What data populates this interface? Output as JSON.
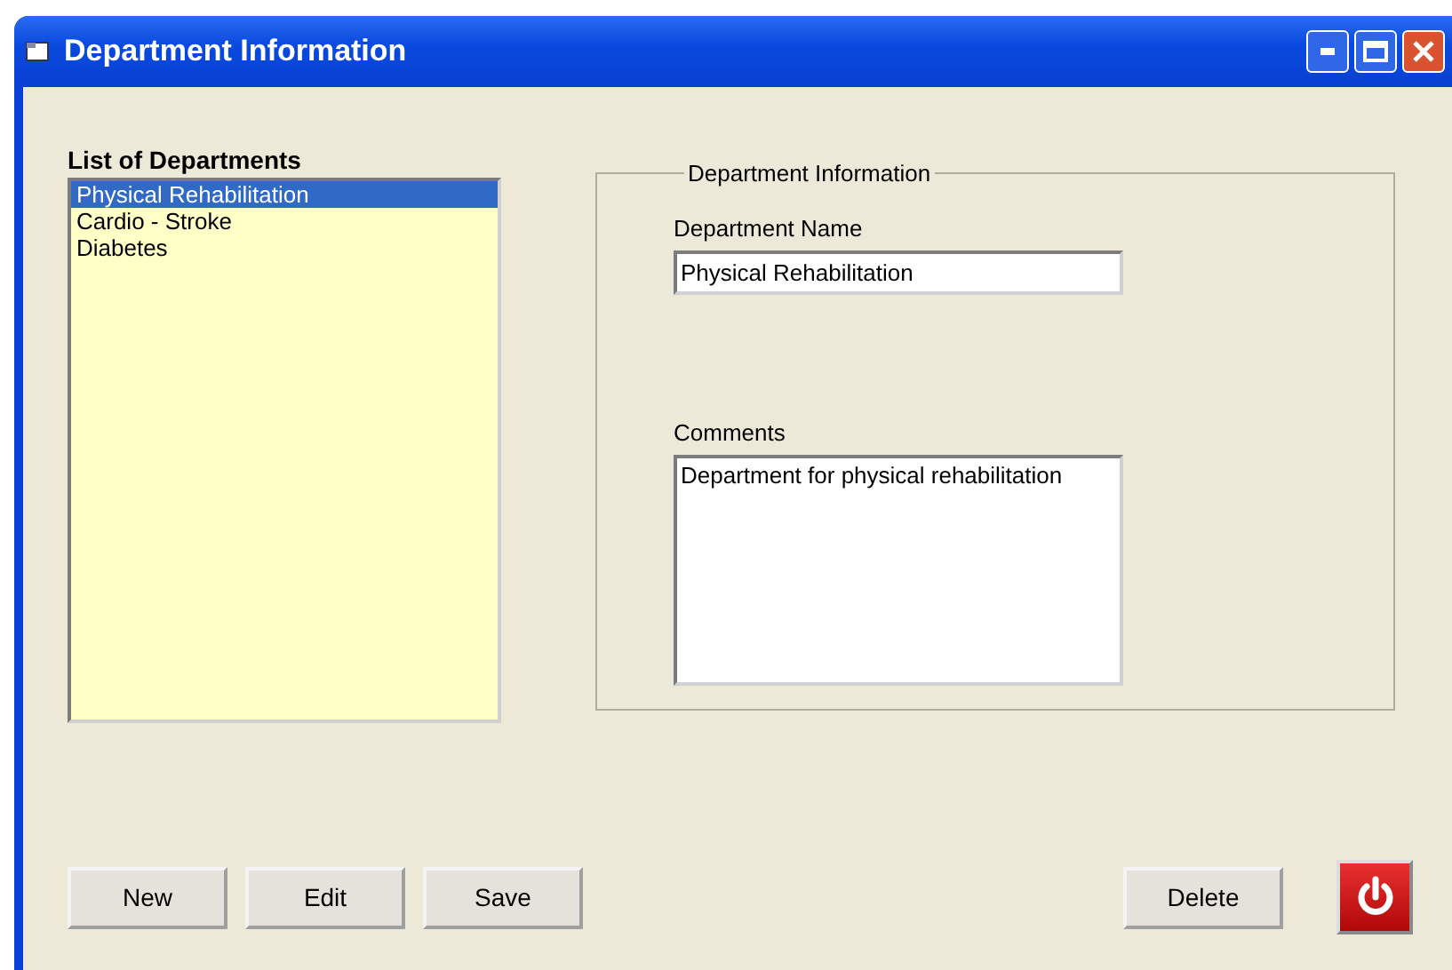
{
  "window": {
    "title": "Department Information"
  },
  "list": {
    "title": "List of Departments",
    "items": [
      {
        "label": "Physical Rehabilitation",
        "selected": true
      },
      {
        "label": "Cardio - Stroke",
        "selected": false
      },
      {
        "label": "Diabetes",
        "selected": false
      }
    ]
  },
  "group": {
    "title": "Department Information",
    "name_label": "Department Name",
    "name_value": "Physical Rehabilitation",
    "comments_label": "Comments",
    "comments_value": "Department for physical rehabilitation"
  },
  "buttons": [
    {
      "label": "New"
    },
    {
      "label": "Edit"
    },
    {
      "label": "Save"
    }
  ],
  "right_buttons": [
    {
      "label": "Delete"
    }
  ]
}
